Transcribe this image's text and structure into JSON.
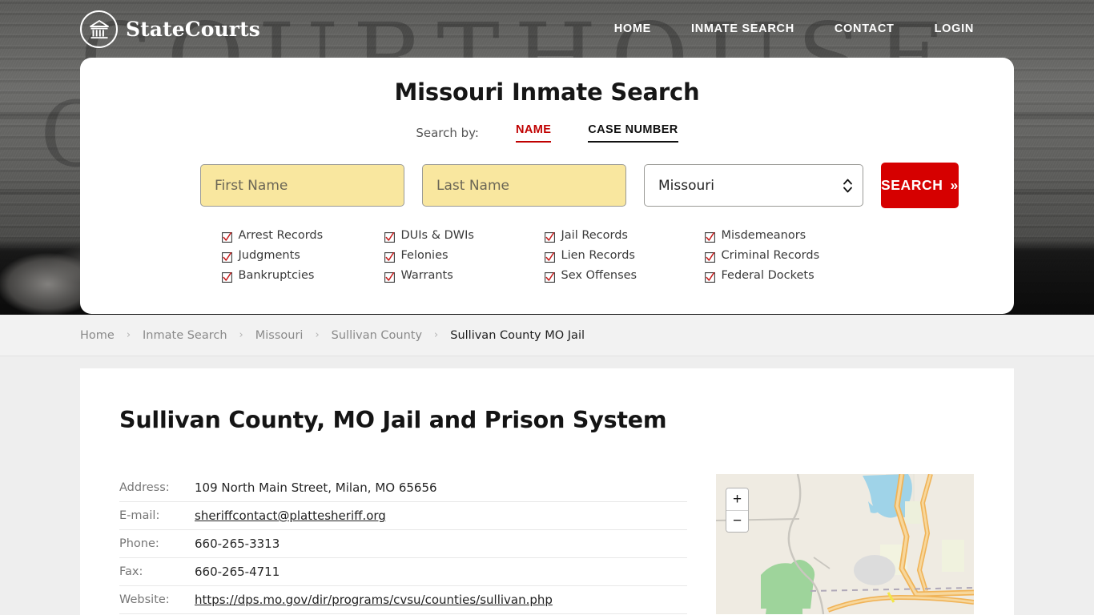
{
  "header": {
    "brand_name": "StateCourts",
    "brand_icon": "courthouse-circle-icon",
    "watermark_line1": "COURTHOUSE",
    "watermark_line2": "COURTHOUSE",
    "nav": [
      {
        "label": "HOME",
        "name": "home"
      },
      {
        "label": "INMATE SEARCH",
        "name": "inmate-search"
      },
      {
        "label": "CONTACT",
        "name": "contact"
      },
      {
        "label": "LOGIN",
        "name": "login"
      }
    ]
  },
  "search_card": {
    "title": "Missouri Inmate Search",
    "search_by_label": "Search by:",
    "tabs": [
      {
        "label": "NAME",
        "active": true
      },
      {
        "label": "CASE NUMBER",
        "active": false
      }
    ],
    "first_name_placeholder": "First Name",
    "first_name_value": "",
    "last_name_placeholder": "Last Name",
    "last_name_value": "",
    "state_selected": "Missouri",
    "search_button": "SEARCH",
    "search_button_chevron": "»",
    "accent_red": "#D60000",
    "tab_active_red": "#C00000",
    "field_yellow": "#F9E79F",
    "checkboxes": [
      {
        "label": "Arrest Records",
        "checked": true
      },
      {
        "label": "DUIs & DWIs",
        "checked": true
      },
      {
        "label": "Jail Records",
        "checked": true
      },
      {
        "label": "Misdemeanors",
        "checked": true
      },
      {
        "label": "Judgments",
        "checked": true
      },
      {
        "label": "Felonies",
        "checked": true
      },
      {
        "label": "Lien Records",
        "checked": true
      },
      {
        "label": "Criminal Records",
        "checked": true
      },
      {
        "label": "Bankruptcies",
        "checked": true
      },
      {
        "label": "Warrants",
        "checked": true
      },
      {
        "label": "Sex Offenses",
        "checked": true
      },
      {
        "label": "Federal Dockets",
        "checked": true
      }
    ]
  },
  "breadcrumb": [
    {
      "label": "Home",
      "current": false
    },
    {
      "label": "Inmate Search",
      "current": false
    },
    {
      "label": "Missouri",
      "current": false
    },
    {
      "label": "Sullivan County",
      "current": false
    },
    {
      "label": "Sullivan County MO Jail",
      "current": true
    }
  ],
  "breadcrumb_separator": "›",
  "main": {
    "page_title": "Sullivan County, MO Jail and Prison System",
    "info_rows": [
      {
        "label": "Address:",
        "value": "109 North Main Street, Milan, MO 65656",
        "is_link": false
      },
      {
        "label": "E-mail:",
        "value": "sheriffcontact@plattesheriff.org",
        "is_link": true
      },
      {
        "label": "Phone:",
        "value": "660-265-3313",
        "is_link": false
      },
      {
        "label": "Fax:",
        "value": "660-265-4711",
        "is_link": false
      },
      {
        "label": "Website:",
        "value": "https://dps.mo.gov/dir/programs/cvsu/counties/sullivan.php",
        "is_link": true
      }
    ],
    "map": {
      "zoom_in_label": "+",
      "zoom_out_label": "−",
      "land_color": "#EFEBE2",
      "water_color": "#9FD3E8",
      "forest_color": "#9ED49B",
      "highway_color": "#F5B95C"
    }
  }
}
